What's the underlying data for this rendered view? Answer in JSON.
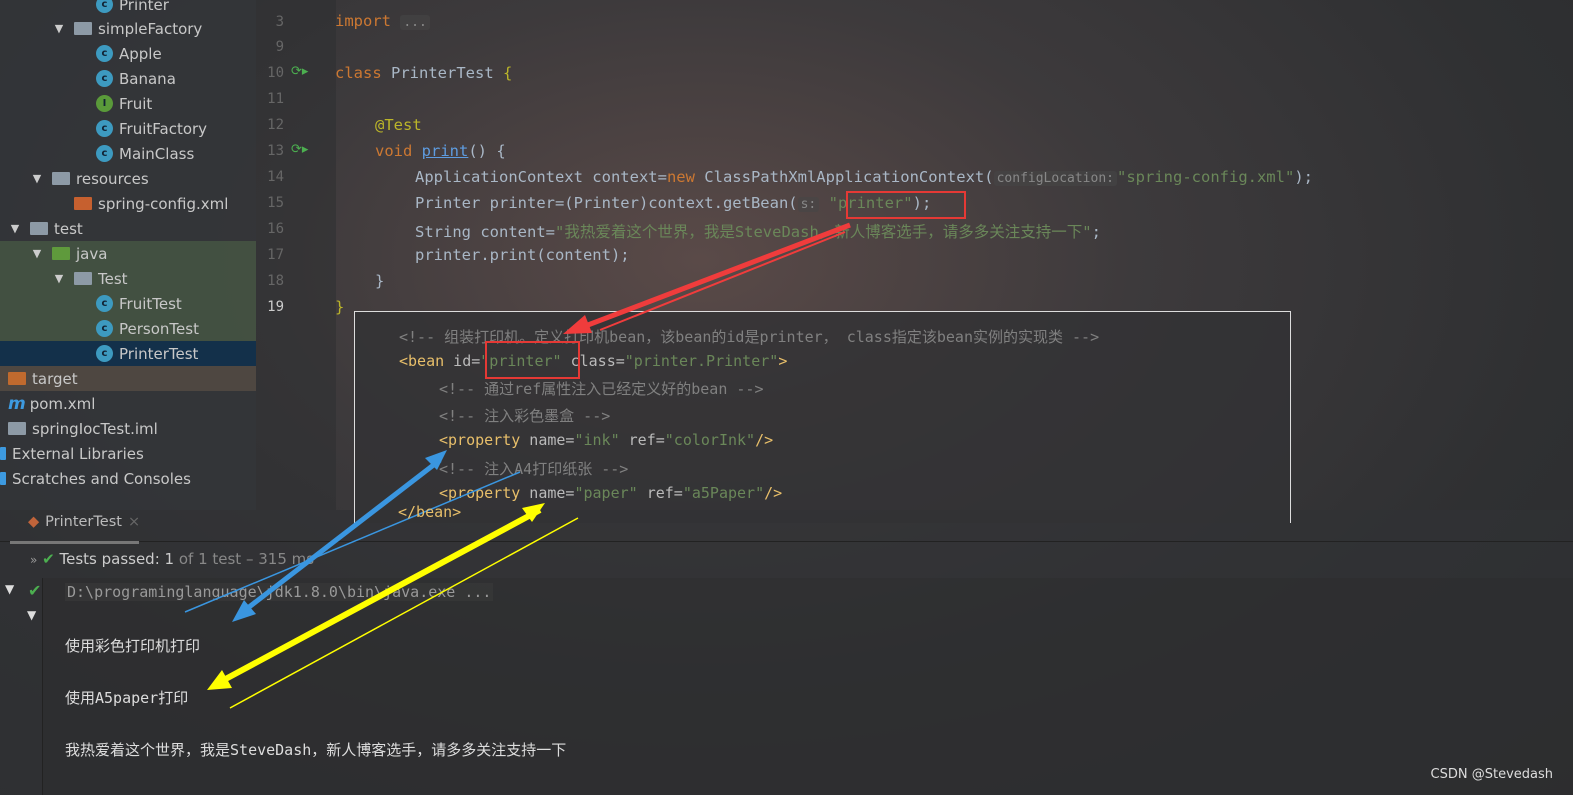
{
  "sidebar": {
    "items": [
      {
        "label": "Printer",
        "icon": "class-icon",
        "level": 4
      },
      {
        "label": "simpleFactory",
        "icon": "package-icon",
        "level": 3,
        "expanded": true
      },
      {
        "label": "Apple",
        "icon": "class-icon",
        "level": 4
      },
      {
        "label": "Banana",
        "icon": "class-icon",
        "level": 4
      },
      {
        "label": "Fruit",
        "icon": "interface-icon",
        "level": 4
      },
      {
        "label": "FruitFactory",
        "icon": "class-icon",
        "level": 4
      },
      {
        "label": "MainClass",
        "icon": "runnable-class-icon",
        "level": 4
      },
      {
        "label": "resources",
        "icon": "resources-folder-icon",
        "level": 2,
        "expanded": true
      },
      {
        "label": "spring-config.xml",
        "icon": "spring-xml-icon",
        "level": 3
      },
      {
        "label": "test",
        "icon": "folder-icon",
        "level": 1,
        "expanded": true
      },
      {
        "label": "java",
        "icon": "test-folder-icon",
        "level": 2,
        "expanded": true
      },
      {
        "label": "Test",
        "icon": "package-icon",
        "level": 3,
        "expanded": true
      },
      {
        "label": "FruitTest",
        "icon": "test-class-icon",
        "level": 4
      },
      {
        "label": "PersonTest",
        "icon": "test-class-icon",
        "level": 4
      },
      {
        "label": "PrinterTest",
        "icon": "test-class-icon",
        "level": 4,
        "selected": true
      },
      {
        "label": "target",
        "icon": "excluded-folder-icon",
        "level": 0
      },
      {
        "label": "pom.xml",
        "icon": "maven-icon",
        "level": 0
      },
      {
        "label": "springIocTest.iml",
        "icon": "iml-file-icon",
        "level": 0
      },
      {
        "label": "External Libraries",
        "icon": "libraries-icon",
        "level": -1
      },
      {
        "label": "Scratches and Consoles",
        "icon": "scratches-icon",
        "level": -1
      }
    ]
  },
  "editor": {
    "line_numbers": [
      "3",
      "9",
      "10",
      "11",
      "12",
      "13",
      "14",
      "15",
      "16",
      "17",
      "18",
      "19"
    ],
    "import_kw": "import",
    "import_fold": "...",
    "class_kw": "class",
    "class_name": "PrinterTest",
    "brace_open": "{",
    "annotation": "@Test",
    "void_kw": "void",
    "method": "print",
    "method_tail": "() {",
    "l14a": "ApplicationContext context=",
    "l14new": "new",
    "l14b": " ClassPathXmlApplicationContext(",
    "l14hint": "configLocation:",
    "l14str": "\"spring-config.xml\"",
    "l14end": ");",
    "l15a": "Printer printer=(Printer)context.getBean(",
    "l15hint": "s:",
    "l15str": "\"printer\"",
    "l15end": ");",
    "l16a": "String content=",
    "l16str": "\"我热爱着这个世界，我是SteveDash，新人博客选手，请多多关注支持一下\"",
    "l16end": ";",
    "l17": "printer.print(content);",
    "l18": "}",
    "l19": "}"
  },
  "xml": {
    "c1": "<!-- 组装打印机。定义打印机bean，该bean的id是printer， class指定该bean实例的实现类 -->",
    "bean_open": "<bean",
    "id_attr": " id=",
    "id_val": "\"printer\"",
    "class_attr": " class=",
    "class_val": "\"printer.Printer\"",
    "gt": ">",
    "c2": "<!-- 通过ref属性注入已经定义好的bean -->",
    "c3": "<!-- 注入彩色墨盒 -->",
    "p1_tag": "<property",
    "p1_name_attr": " name=",
    "p1_name": "\"ink\"",
    "p1_ref_attr": " ref=",
    "p1_ref": "\"colorInk\"",
    "p1_end": "/>",
    "c4": "<!-- 注入A4打印纸张 -->",
    "p2_tag": "<property",
    "p2_name_attr": " name=",
    "p2_name": "\"paper\"",
    "p2_ref_attr": " ref=",
    "p2_ref": "\"a5Paper\"",
    "p2_end": "/>",
    "bean_close": "</bean>"
  },
  "run": {
    "tab_label": "PrinterTest",
    "status_main": "Tests passed: 1",
    "status_rest": " of 1 test – 315 ms",
    "console": [
      "D:\\programinglanguage\\jdk1.8.0\\bin\\java.exe ...",
      "使用彩色打印机打印",
      "使用A5paper打印",
      "我热爱着这个世界，我是SteveDash，新人博客选手，请多多关注支持一下"
    ]
  },
  "watermark": "CSDN @Stevedash",
  "colors": {
    "red_arrow": "#f03c3c",
    "blue_arrow": "#3a96e0",
    "yellow_arrow": "#ffff00"
  }
}
